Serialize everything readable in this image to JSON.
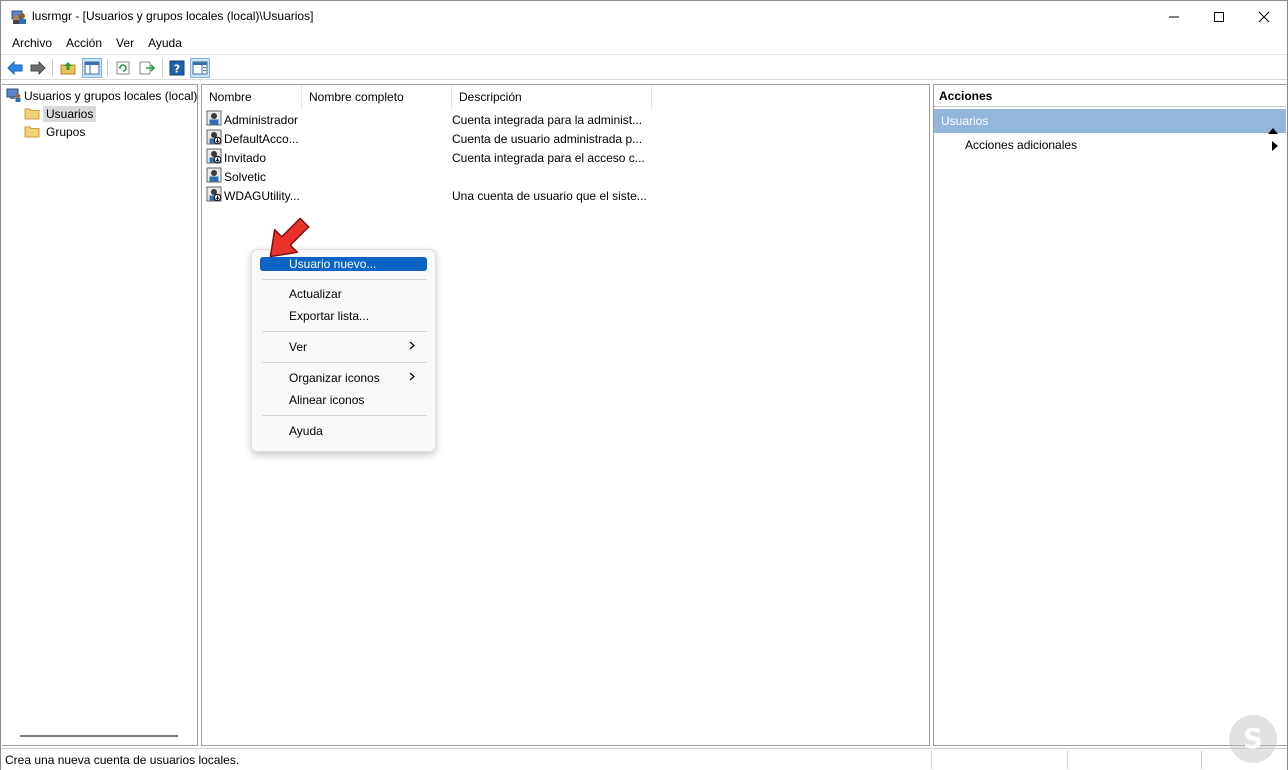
{
  "window": {
    "title": "lusrmgr - [Usuarios y grupos locales (local)\\Usuarios]"
  },
  "menu": [
    "Archivo",
    "Acción",
    "Ver",
    "Ayuda"
  ],
  "tree": {
    "root": "Usuarios y grupos locales (local)",
    "children": [
      "Usuarios",
      "Grupos"
    ],
    "selected": "Usuarios"
  },
  "list": {
    "columns": [
      "Nombre",
      "Nombre completo",
      "Descripción"
    ],
    "rows": [
      {
        "name": "Administrador",
        "full_name": "",
        "description": "Cuenta integrada para la administ..."
      },
      {
        "name": "DefaultAcco...",
        "full_name": "",
        "description": "Cuenta de usuario administrada p..."
      },
      {
        "name": "Invitado",
        "full_name": "",
        "description": "Cuenta integrada para el acceso c..."
      },
      {
        "name": "Solvetic",
        "full_name": "",
        "description": ""
      },
      {
        "name": "WDAGUtility...",
        "full_name": "",
        "description": "Una cuenta de usuario que el siste..."
      }
    ]
  },
  "context_menu": {
    "items": [
      "Usuario nuevo...",
      "Actualizar",
      "Exportar lista...",
      "Ver",
      "Organizar iconos",
      "Alinear iconos",
      "Ayuda"
    ],
    "highlighted": "Usuario nuevo..."
  },
  "actions": {
    "header": "Acciones",
    "section": "Usuarios",
    "items": [
      "Acciones adicionales"
    ]
  },
  "status": {
    "text": "Crea una nueva cuenta de usuarios locales."
  },
  "colors": {
    "selection": "#0b63c4",
    "actions_section": "#93b7db",
    "annotation_arrow": "#e8322b"
  }
}
